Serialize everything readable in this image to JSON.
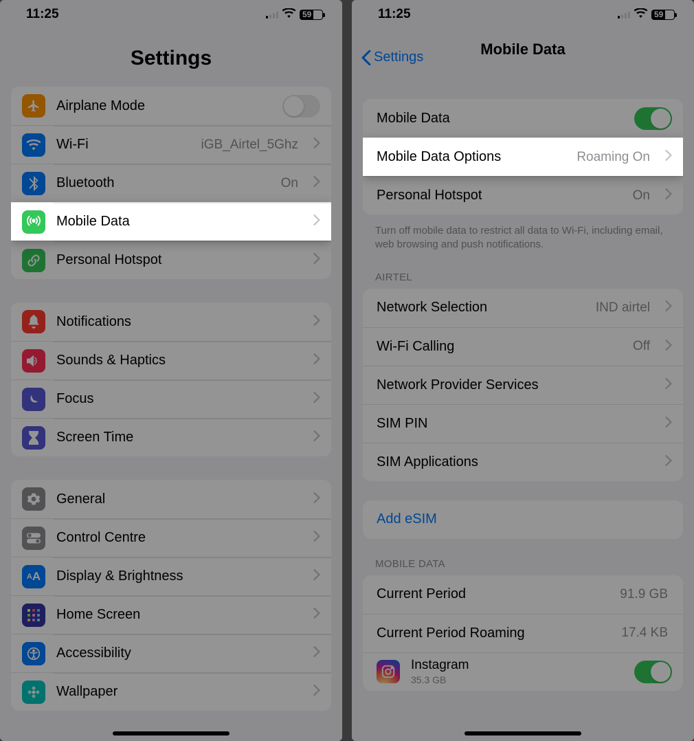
{
  "status": {
    "time": "11:25",
    "battery": "59"
  },
  "screen1": {
    "title": "Settings",
    "group1": [
      {
        "icon": "airplane",
        "color": "#ff9500",
        "label": "Airplane Mode",
        "toggle": false
      },
      {
        "icon": "wifi",
        "color": "#007aff",
        "label": "Wi-Fi",
        "detail": "iGB_Airtel_5Ghz"
      },
      {
        "icon": "bluetooth",
        "color": "#007aff",
        "label": "Bluetooth",
        "detail": "On"
      },
      {
        "icon": "antenna",
        "color": "#34c759",
        "label": "Mobile Data",
        "highlighted": true
      },
      {
        "icon": "link",
        "color": "#34c759",
        "label": "Personal Hotspot"
      }
    ],
    "group2": [
      {
        "icon": "bell",
        "color": "#ff3b30",
        "label": "Notifications"
      },
      {
        "icon": "speaker",
        "color": "#ff2d55",
        "label": "Sounds & Haptics"
      },
      {
        "icon": "moon",
        "color": "#5856d6",
        "label": "Focus"
      },
      {
        "icon": "hourglass",
        "color": "#5856d6",
        "label": "Screen Time"
      }
    ],
    "group3": [
      {
        "icon": "gear",
        "color": "#8e8e93",
        "label": "General"
      },
      {
        "icon": "switches",
        "color": "#8e8e93",
        "label": "Control Centre"
      },
      {
        "icon": "aa",
        "color": "#007aff",
        "label": "Display & Brightness"
      },
      {
        "icon": "grid",
        "color": "#3634a3",
        "label": "Home Screen"
      },
      {
        "icon": "person",
        "color": "#007aff",
        "label": "Accessibility"
      },
      {
        "icon": "flower",
        "color": "#00c7be",
        "label": "Wallpaper"
      }
    ]
  },
  "screen2": {
    "back": "Settings",
    "title": "Mobile Data",
    "group1": [
      {
        "label": "Mobile Data",
        "toggle": true
      },
      {
        "label": "Mobile Data Options",
        "detail": "Roaming On",
        "highlighted": true
      },
      {
        "label": "Personal Hotspot",
        "detail": "On"
      }
    ],
    "footer1": "Turn off mobile data to restrict all data to Wi-Fi, including email, web browsing and push notifications.",
    "carrier_header": "AIRTEL",
    "group2": [
      {
        "label": "Network Selection",
        "detail": "IND airtel"
      },
      {
        "label": "Wi-Fi Calling",
        "detail": "Off"
      },
      {
        "label": "Network Provider Services"
      },
      {
        "label": "SIM PIN"
      },
      {
        "label": "SIM Applications"
      }
    ],
    "add_esim": "Add eSIM",
    "usage_header": "MOBILE DATA",
    "usage": [
      {
        "label": "Current Period",
        "detail": "91.9 GB"
      },
      {
        "label": "Current Period Roaming",
        "detail": "17.4 KB"
      }
    ],
    "app": {
      "name": "Instagram",
      "usage": "35.3 GB",
      "toggle": true
    }
  }
}
